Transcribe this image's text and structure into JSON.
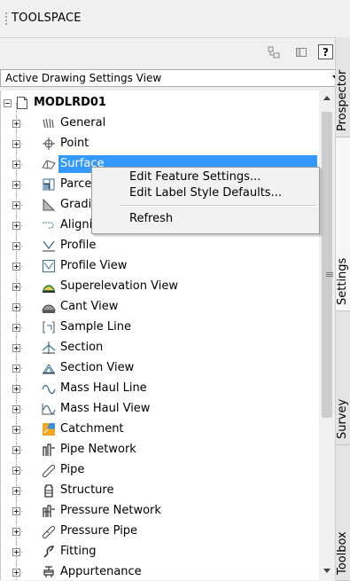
{
  "panel": {
    "title": "TOOLSPACE"
  },
  "toolbar": {
    "help_label": "?"
  },
  "view_selector": {
    "selected": "Active Drawing Settings View"
  },
  "tree": {
    "root": "MODLRD01",
    "items": [
      {
        "label": "General",
        "icon": "general-settings-icon"
      },
      {
        "label": "Point",
        "icon": "point-icon"
      },
      {
        "label": "Surface",
        "icon": "surface-icon",
        "selected": true
      },
      {
        "label": "Parce",
        "icon": "parcel-icon"
      },
      {
        "label": "Gradi",
        "icon": "grading-icon"
      },
      {
        "label": "Aligni",
        "icon": "alignment-icon"
      },
      {
        "label": "Profile",
        "icon": "profile-icon"
      },
      {
        "label": "Profile View",
        "icon": "profile-view-icon"
      },
      {
        "label": "Superelevation View",
        "icon": "superelevation-view-icon"
      },
      {
        "label": "Cant View",
        "icon": "cant-view-icon"
      },
      {
        "label": "Sample Line",
        "icon": "sample-line-icon"
      },
      {
        "label": "Section",
        "icon": "section-icon"
      },
      {
        "label": "Section View",
        "icon": "section-view-icon"
      },
      {
        "label": "Mass Haul Line",
        "icon": "mass-haul-line-icon"
      },
      {
        "label": "Mass Haul View",
        "icon": "mass-haul-view-icon"
      },
      {
        "label": "Catchment",
        "icon": "catchment-icon"
      },
      {
        "label": "Pipe Network",
        "icon": "pipe-network-icon"
      },
      {
        "label": "Pipe",
        "icon": "pipe-icon"
      },
      {
        "label": "Structure",
        "icon": "structure-icon"
      },
      {
        "label": "Pressure Network",
        "icon": "pressure-network-icon"
      },
      {
        "label": "Pressure Pipe",
        "icon": "pressure-pipe-icon"
      },
      {
        "label": "Fitting",
        "icon": "fitting-icon"
      },
      {
        "label": "Appurtenance",
        "icon": "appurtenance-icon"
      }
    ]
  },
  "context_menu": {
    "items": [
      "Edit Feature Settings...",
      "Edit Label Style Defaults...",
      "Refresh"
    ]
  },
  "side_tabs": [
    "Prospector",
    "Settings",
    "Survey",
    "Toolbox"
  ],
  "colors": {
    "selection": "#3399ff",
    "panel_bg": "#f0f0f0"
  }
}
